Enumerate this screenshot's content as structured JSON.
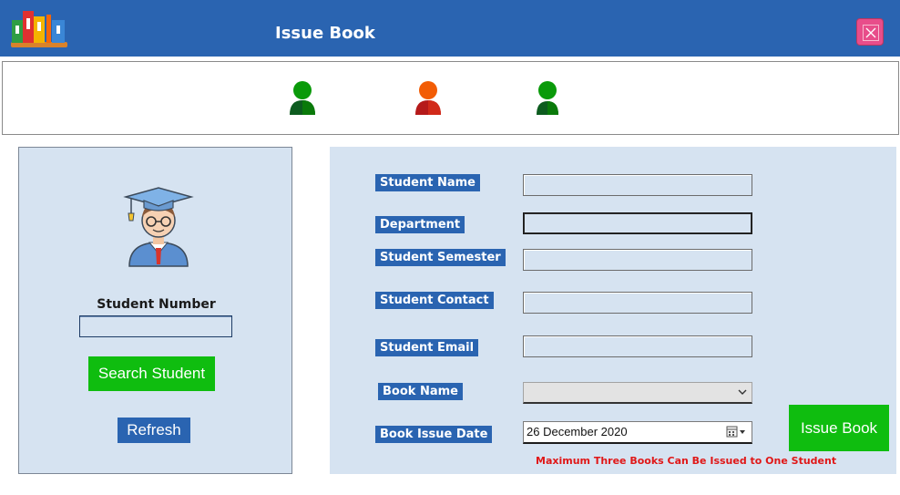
{
  "window": {
    "title": "Issue Book"
  },
  "toolbar": {
    "icons": [
      "user-icon",
      "user-icon",
      "user-icon"
    ],
    "colors": {
      "green": "#0a9a0a",
      "orange": "#f25c05",
      "dark_green": "#0a7a0a"
    }
  },
  "left_panel": {
    "student_number_label": "Student Number",
    "student_number_value": "",
    "search_button": "Search Student",
    "refresh_button": "Refresh"
  },
  "form": {
    "student_name_label": "Student Name",
    "department_label": "Department",
    "semester_label": "Student Semester",
    "contact_label": "Student Contact",
    "email_label": "Student Email",
    "book_name_label": "Book Name",
    "issue_date_label": "Book Issue Date",
    "student_name_value": "",
    "department_value": "",
    "semester_value": "",
    "contact_value": "",
    "email_value": "",
    "book_name_selected": "",
    "issue_date_value": "26 December  2020",
    "issue_button": "Issue Book",
    "note": "Maximum Three Books Can Be Issued to One Student"
  },
  "colors": {
    "title_bar": "#2a64b1",
    "panel": "#d6e3f1",
    "label_bg": "#2a64b1",
    "action_green": "#0fbd0f",
    "warning_text": "#e01717",
    "close_button": "#e84d8a"
  }
}
